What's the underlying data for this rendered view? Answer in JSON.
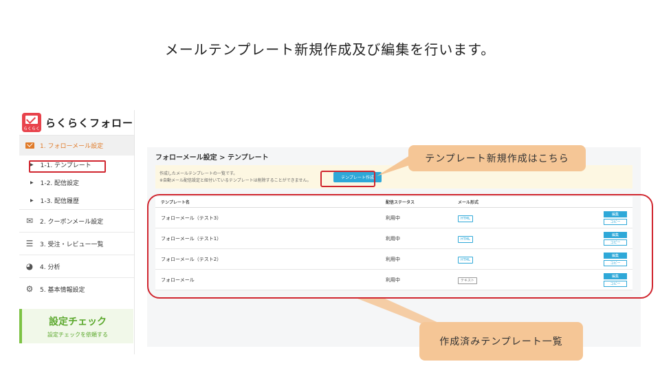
{
  "heading": "メールテンプレート新規作成及び編集を行います。",
  "brand": {
    "name": "らくらくフォロー",
    "icon_text": "らくらく",
    "icon": "mail-logo-icon"
  },
  "sidebar": {
    "section_active": "1. フォローメール設定",
    "subitems": [
      "1-1. テンプレート",
      "1-2. 配信設定",
      "1-3. 配信履歴"
    ],
    "items": [
      {
        "label": "2. クーポンメール設定",
        "icon": "coupon-icon"
      },
      {
        "label": "3. 受注・レビュー一覧",
        "icon": "list-icon"
      },
      {
        "label": "4. 分析",
        "icon": "pie-chart-icon"
      },
      {
        "label": "5. 基本情報設定",
        "icon": "gear-icon"
      }
    ],
    "check_title": "設定チェック",
    "check_sub": "設定チェックを依頼する"
  },
  "main": {
    "breadcrumb": "フォローメール設定 > テンプレート",
    "notice_line1": "作成したメールテンプレートの一覧です。",
    "notice_line2": "※自動メール配信設定と紐付いているテンプレートは削除することができません。",
    "create_button": "テンプレート作成",
    "columns": {
      "name": "テンプレート名",
      "status": "配信ステータス",
      "format": "メール形式"
    },
    "rows": [
      {
        "name": "フォローメール（テスト3）",
        "status": "利用中",
        "format": "HTML"
      },
      {
        "name": "フォローメール（テスト1）",
        "status": "利用中",
        "format": "HTML"
      },
      {
        "name": "フォローメール（テスト2）",
        "status": "利用中",
        "format": "HTML"
      },
      {
        "name": "フォローメール",
        "status": "利用中",
        "format": "テキスト"
      }
    ],
    "edit_label": "編集",
    "copy_label": "コピー"
  },
  "callouts": {
    "top": "テンプレート新規作成はこちら",
    "bottom": "作成済みテンプレート一覧"
  },
  "colors": {
    "highlight": "#d0252e",
    "callout": "#f5c696",
    "accent": "#2ea8d8",
    "brand": "#e8434c",
    "active": "#e07b2a",
    "check": "#5ba82c"
  }
}
